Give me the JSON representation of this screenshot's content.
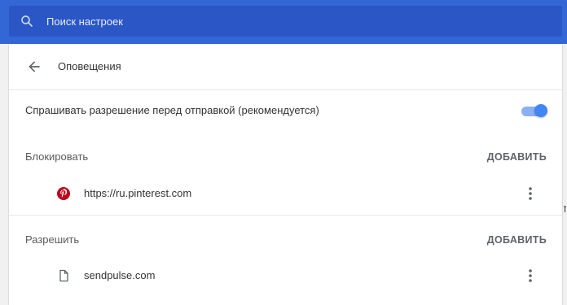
{
  "search": {
    "placeholder": "Поиск настроек",
    "icon": "search-icon"
  },
  "header": {
    "title": "Оповещения",
    "back_icon": "arrow-back-icon"
  },
  "ask_toggle": {
    "label": "Спрашивать разрешение перед отправкой (рекомендуется)",
    "enabled": true
  },
  "block_section": {
    "label": "Блокировать",
    "add_label": "ДОБАВИТЬ",
    "sites": [
      {
        "url": "https://ru.pinterest.com",
        "favicon": "pinterest-icon"
      }
    ]
  },
  "allow_section": {
    "label": "Разрешить",
    "add_label": "ДОБАВИТЬ",
    "sites": [
      {
        "url": "sendpulse.com",
        "favicon": "page-icon"
      }
    ]
  },
  "colors": {
    "header_bg": "#3367d6",
    "search_bg": "#2a56c6",
    "toggle_on": "#4285f4",
    "pinterest_red": "#bd081c"
  }
}
